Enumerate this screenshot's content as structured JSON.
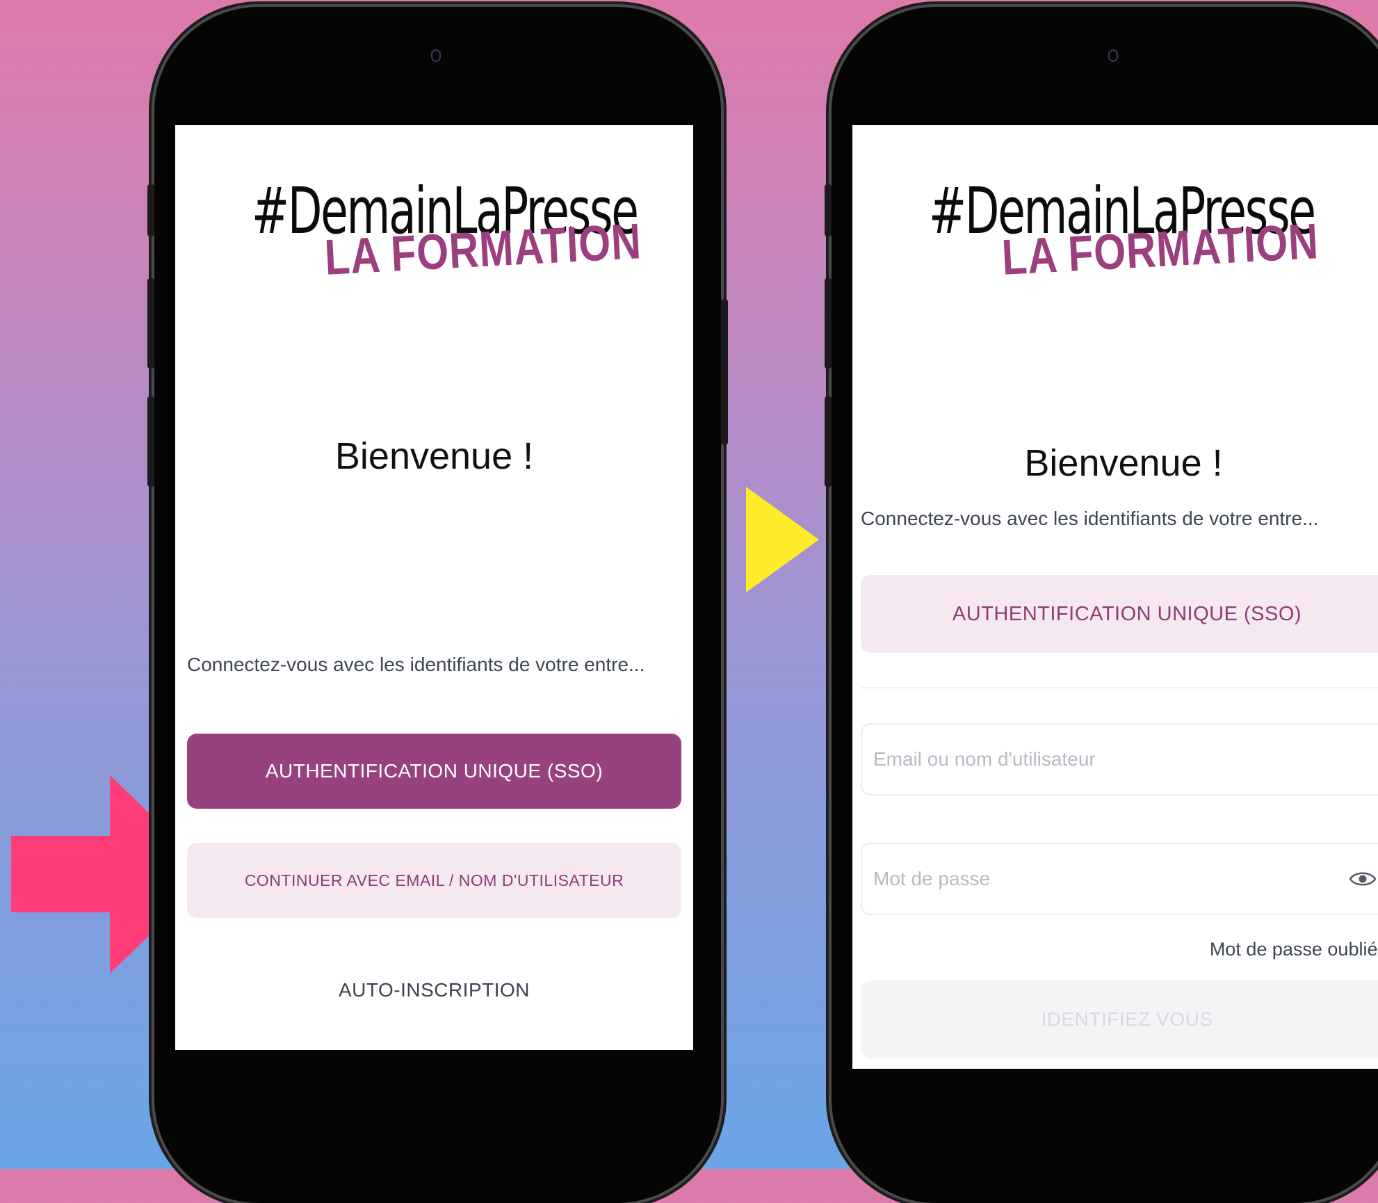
{
  "logo": {
    "hashtag": "#DemainLaPresse",
    "subtitle": "LA FORMATION"
  },
  "left_screen": {
    "welcome": "Bienvenue !",
    "subtitle": "Connectez-vous avec les identifiants de votre entre...",
    "sso_button": "AUTHENTIFICATION UNIQUE (SSO)",
    "email_button": "CONTINUER AVEC EMAIL / NOM D'UTILISATEUR",
    "signup_button": "AUTO-INSCRIPTION"
  },
  "right_screen": {
    "welcome": "Bienvenue !",
    "subtitle": "Connectez-vous avec les identifiants de votre entre...",
    "sso_button": "AUTHENTIFICATION UNIQUE (SSO)",
    "email_placeholder": "Email ou nom d'utilisateur",
    "password_placeholder": "Mot de passe",
    "forgot_password": "Mot de passe oublié ?",
    "submit_button": "IDENTIFIEZ VOUS"
  },
  "colors": {
    "brand": "#98417f",
    "brand_soft": "#f6e8f1",
    "arrow_pink": "#ff3b78",
    "arrow_yellow": "#ffeb2a"
  },
  "icons": [
    "eye-icon",
    "right-arrow-icon",
    "play-triangle-icon"
  ]
}
